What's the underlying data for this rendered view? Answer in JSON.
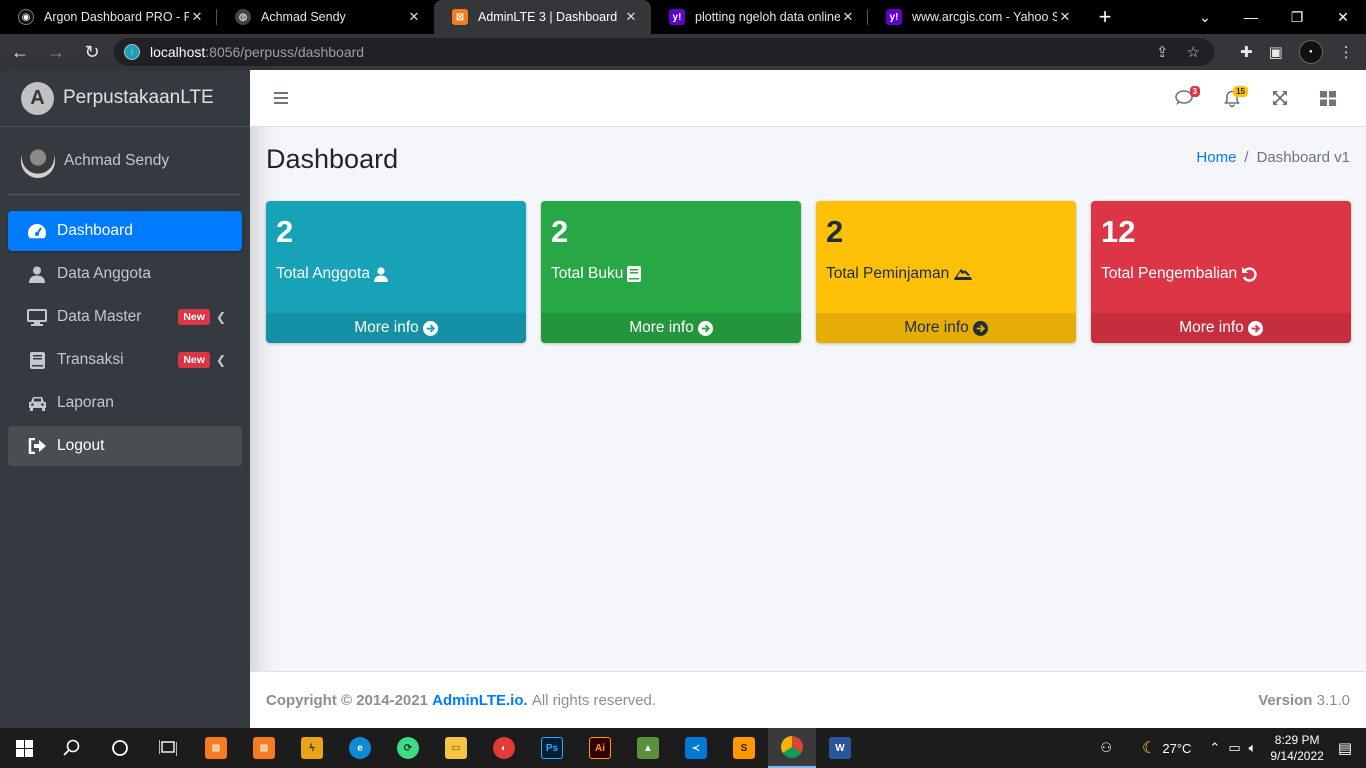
{
  "browser": {
    "tabs": [
      {
        "title": "Argon Dashboard PRO - Premium",
        "fav_color": "#111111",
        "fav_glyph": "◉",
        "active": false
      },
      {
        "title": "Achmad Sendy",
        "fav_color": "#333333",
        "fav_glyph": "◍",
        "active": false
      },
      {
        "title": "AdminLTE 3 | Dashboard",
        "fav_color": "#f47b20",
        "fav_glyph": "⊠",
        "active": true
      },
      {
        "title": "plotting ngeloh data online -",
        "fav_color": "#6001d2",
        "fav_glyph": "y!",
        "active": false
      },
      {
        "title": "www.arcgis.com - Yahoo Search",
        "fav_color": "#6001d2",
        "fav_glyph": "y!",
        "active": false
      }
    ],
    "address": {
      "host": "localhost",
      "path": ":8056/perpuss/dashboard"
    }
  },
  "sidebar": {
    "brand": "PerpustakaanLTE",
    "user": "Achmad Sendy",
    "items": [
      {
        "label": "Dashboard",
        "icon": "tachometer-icon",
        "active": true
      },
      {
        "label": "Data Anggota",
        "icon": "user-icon"
      },
      {
        "label": "Data Master",
        "icon": "desktop-icon",
        "badge": "New"
      },
      {
        "label": "Transaksi",
        "icon": "book-icon",
        "badge": "New"
      },
      {
        "label": "Laporan",
        "icon": "car-icon"
      },
      {
        "label": "Logout",
        "icon": "sign-out-icon"
      }
    ]
  },
  "navbar": {
    "messages_count": "3",
    "notifications_count": "15"
  },
  "content": {
    "title": "Dashboard",
    "breadcrumb": {
      "home": "Home",
      "separator": "/",
      "current": "Dashboard v1"
    },
    "boxes": [
      {
        "value": "2",
        "label": "Total Anggota",
        "more": "More info",
        "color": "#17a2b8"
      },
      {
        "value": "2",
        "label": "Total Buku",
        "more": "More info",
        "color": "#28a745"
      },
      {
        "value": "2",
        "label": "Total Peminjaman",
        "more": "More info",
        "color": "#ffc107"
      },
      {
        "value": "12",
        "label": "Total Pengembalian",
        "more": "More info",
        "color": "#dc3545"
      }
    ]
  },
  "footer": {
    "copyright_prefix": "Copyright © 2014-2021",
    "link": "AdminLTE.io.",
    "suffix": "All rights reserved.",
    "version_label": "Version",
    "version": "3.1.0"
  },
  "taskbar": {
    "temperature": "27°C",
    "time": "8:29 PM",
    "date": "9/14/2022"
  }
}
